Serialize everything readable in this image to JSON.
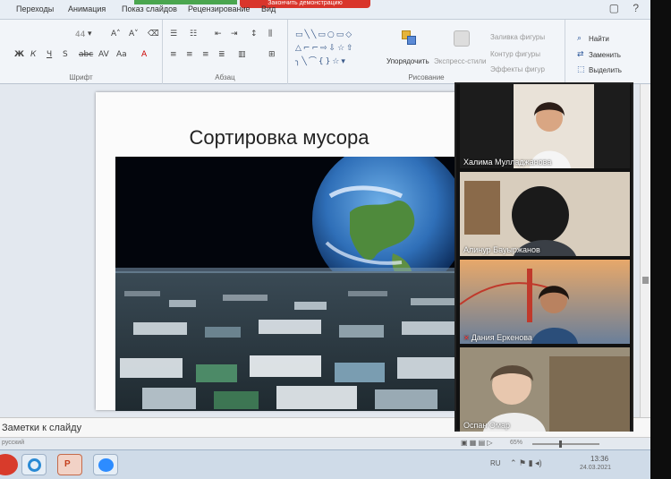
{
  "ribbon": {
    "tabs": [
      "Переходы",
      "Анимация",
      "Показ слайдов",
      "Рецензирование",
      "Вид"
    ],
    "demo_banner": "Закончить демонстрацию",
    "font_size": "44",
    "groups": {
      "font": "Шрифт",
      "paragraph": "Абзац",
      "drawing": "Рисование"
    },
    "buttons": {
      "arrange": "Упорядочить",
      "quick_styles": "Экспресс-стили",
      "shape_fill": "Заливка фигуры",
      "shape_outline": "Контур фигуры",
      "shape_effects": "Эффекты фигур",
      "find": "Найти",
      "replace": "Заменить",
      "select": "Выделить"
    }
  },
  "slide": {
    "title": "Сортировка мусора"
  },
  "video": {
    "participants": [
      {
        "name": "Халима Мулладжанова",
        "muted": false
      },
      {
        "name": "Алинур Бауыржанов",
        "muted": false
      },
      {
        "name": "Дания Еркенова",
        "muted": true
      },
      {
        "name": "Оспан Омар",
        "muted": false
      }
    ]
  },
  "notes": {
    "placeholder": "Заметки к слайду"
  },
  "status": {
    "language": "русский",
    "zoom": "65%"
  },
  "taskbar": {
    "lang": "RU",
    "time": "13:36",
    "date": "24.03.2021"
  },
  "colors": {
    "accent": "#2b579a",
    "banner_red": "#d9352b",
    "banner_green": "#4aa64f"
  }
}
